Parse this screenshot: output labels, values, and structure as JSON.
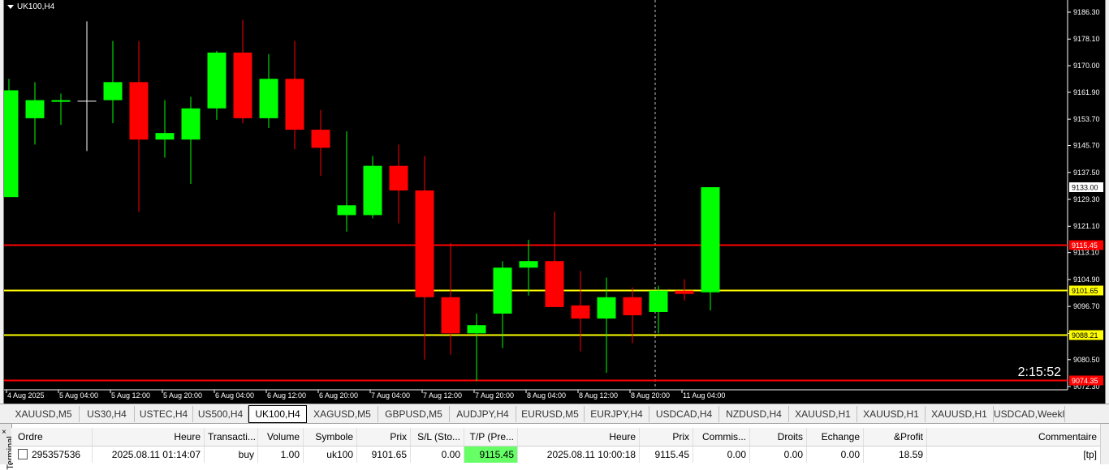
{
  "chart": {
    "symbol_label": "UK100,H4",
    "timer": "2:15:52",
    "colors": {
      "bull": "#00ff00",
      "bear": "#ff0000",
      "bg": "#000000",
      "text": "#ffffff",
      "tp_line": "#ff0000",
      "entry_line": "#ffff00",
      "current_price_box": "#ffffff"
    },
    "price_axis": [
      "9186.30",
      "9178.10",
      "9170.00",
      "9161.90",
      "9153.70",
      "9145.70",
      "9137.50",
      "9129.30",
      "9121.10",
      "9113.10",
      "9104.90",
      "9096.70",
      "9088.50",
      "9080.50",
      "9072.30"
    ],
    "current_price": "9133.00",
    "lines": [
      {
        "label": "9115.45",
        "price": 9115.45,
        "color": "#ff0000",
        "box_text": "#ffffff"
      },
      {
        "label": "9101.65",
        "price": 9101.65,
        "color": "#ffff00",
        "box_text": "#000000"
      },
      {
        "label": "9088.21",
        "price": 9088.21,
        "color": "#ffff00",
        "box_text": "#000000"
      },
      {
        "label": "9074.35",
        "price": 9074.35,
        "color": "#ff0000",
        "box_text": "#ffffff"
      }
    ],
    "time_axis": [
      "4 Aug 2025",
      "5 Aug 04:00",
      "5 Aug 12:00",
      "5 Aug 20:00",
      "6 Aug 04:00",
      "6 Aug 12:00",
      "6 Aug 20:00",
      "7 Aug 04:00",
      "7 Aug 12:00",
      "7 Aug 20:00",
      "8 Aug 04:00",
      "8 Aug 12:00",
      "8 Aug 20:00",
      "11 Aug 04:00"
    ],
    "candles": [
      {
        "o": 9130.0,
        "h": 9166.0,
        "l": 9130.0,
        "c": 9162.5
      },
      {
        "o": 9154.0,
        "h": 9165.0,
        "l": 9146.0,
        "c": 9159.5
      },
      {
        "o": 9159.0,
        "h": 9161.5,
        "l": 9152.0,
        "c": 9159.5
      },
      {
        "o": 9159.2,
        "h": 9183.5,
        "l": 9144.0,
        "c": 9159.2
      },
      {
        "o": 9159.5,
        "h": 9177.5,
        "l": 9152.5,
        "c": 9165.0
      },
      {
        "o": 9165.0,
        "h": 9177.5,
        "l": 9125.5,
        "c": 9147.5
      },
      {
        "o": 9147.5,
        "h": 9159.5,
        "l": 9142.0,
        "c": 9149.5
      },
      {
        "o": 9147.5,
        "h": 9160.5,
        "l": 9134.0,
        "c": 9157.0
      },
      {
        "o": 9157.0,
        "h": 9174.5,
        "l": 9153.5,
        "c": 9174.0
      },
      {
        "o": 9174.0,
        "h": 9184.0,
        "l": 9152.5,
        "c": 9154.0
      },
      {
        "o": 9154.0,
        "h": 9173.5,
        "l": 9151.0,
        "c": 9166.0
      },
      {
        "o": 9166.0,
        "h": 9177.5,
        "l": 9144.5,
        "c": 9150.5
      },
      {
        "o": 9150.5,
        "h": 9156.5,
        "l": 9136.5,
        "c": 9145.0
      },
      {
        "o": 9124.5,
        "h": 9150.0,
        "l": 9119.5,
        "c": 9127.5
      },
      {
        "o": 9124.5,
        "h": 9142.5,
        "l": 9123.5,
        "c": 9139.5
      },
      {
        "o": 9139.5,
        "h": 9146.0,
        "l": 9122.0,
        "c": 9132.0
      },
      {
        "o": 9132.0,
        "h": 9142.5,
        "l": 9080.5,
        "c": 9099.5
      },
      {
        "o": 9099.5,
        "h": 9116.0,
        "l": 9082.0,
        "c": 9088.5
      },
      {
        "o": 9088.5,
        "h": 9094.5,
        "l": 9074.0,
        "c": 9091.0
      },
      {
        "o": 9094.5,
        "h": 9110.5,
        "l": 9084.0,
        "c": 9108.5
      },
      {
        "o": 9108.5,
        "h": 9117.0,
        "l": 9100.0,
        "c": 9110.5
      },
      {
        "o": 9110.5,
        "h": 9125.5,
        "l": 9096.5,
        "c": 9096.5
      },
      {
        "o": 9097.0,
        "h": 9107.5,
        "l": 9083.0,
        "c": 9093.0
      },
      {
        "o": 9093.0,
        "h": 9105.5,
        "l": 9076.5,
        "c": 9099.5
      },
      {
        "o": 9099.5,
        "h": 9102.5,
        "l": 9085.5,
        "c": 9094.0
      },
      {
        "o": 9095.0,
        "h": 9103.0,
        "l": 9088.5,
        "c": 9101.5
      },
      {
        "o": 9101.5,
        "h": 9105.0,
        "l": 9098.5,
        "c": 9100.5
      },
      {
        "o": 9101.0,
        "h": 9133.0,
        "l": 9095.5,
        "c": 9133.0
      }
    ]
  },
  "tabs": [
    {
      "label": "XAUUSD,M5",
      "active": false
    },
    {
      "label": "US30,H4",
      "active": false
    },
    {
      "label": "USTEC,H4",
      "active": false
    },
    {
      "label": "US500,H4",
      "active": false
    },
    {
      "label": "UK100,H4",
      "active": true
    },
    {
      "label": "XAGUSD,M5",
      "active": false
    },
    {
      "label": "GBPUSD,M5",
      "active": false
    },
    {
      "label": "AUDJPY,H4",
      "active": false
    },
    {
      "label": "EURUSD,M5",
      "active": false
    },
    {
      "label": "EURJPY,H4",
      "active": false
    },
    {
      "label": "USDCAD,H4",
      "active": false
    },
    {
      "label": "NZDUSD,H4",
      "active": false
    },
    {
      "label": "XAUUSD,H1",
      "active": false
    },
    {
      "label": "XAUUSD,H1",
      "active": false
    },
    {
      "label": "XAUUSD,H1",
      "active": false
    },
    {
      "label": "USDCAD,Weekl",
      "active": false
    }
  ],
  "terminal": {
    "side_label": "Terminal",
    "close_glyph": "×",
    "columns": [
      "Ordre",
      "Heure",
      "Transacti...",
      "Volume",
      "Symbole",
      "Prix",
      "S/L (Sto...",
      "T/P (Pre...",
      "Heure",
      "Prix",
      "Commis...",
      "Droits",
      "Echange",
      "&Profit",
      "Commentaire"
    ],
    "rows": [
      {
        "order": "295357536",
        "open_time": "2025.08.11 01:14:07",
        "type": "buy",
        "volume": "1.00",
        "symbol": "uk100",
        "open_price": "9101.65",
        "sl": "0.00",
        "tp": "9115.45",
        "close_time": "2025.08.11 10:00:18",
        "close_price": "9115.45",
        "commission": "0.00",
        "swap_fees": "0.00",
        "exchange": "0.00",
        "profit": "18.59",
        "comment": "[tp]"
      }
    ]
  }
}
